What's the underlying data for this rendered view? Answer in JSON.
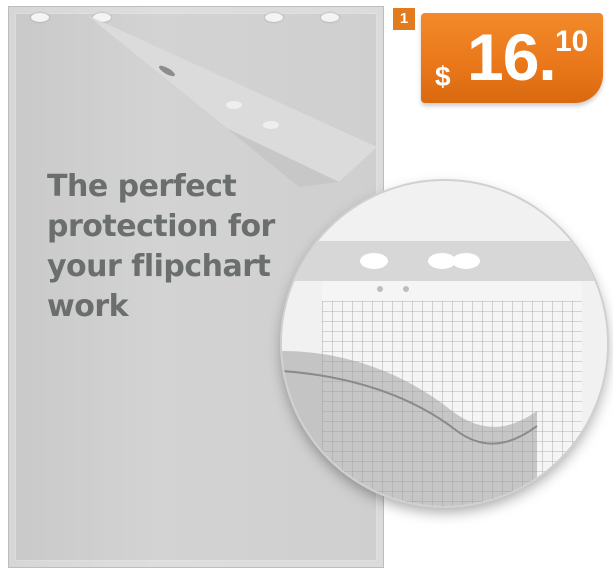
{
  "badge": {
    "number": "1"
  },
  "price": {
    "currency": "$",
    "main": "16.",
    "cents": "10"
  },
  "headline": {
    "lines": [
      "The perfect",
      "protection for",
      "your flipchart",
      "work"
    ]
  },
  "colors": {
    "accent": "#e9771a",
    "headline_text": "#6a6f6e",
    "sheet": "#cfcfcf"
  }
}
